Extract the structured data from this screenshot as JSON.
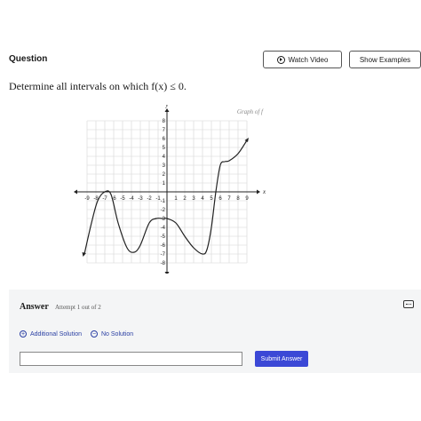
{
  "header": {
    "title": "Question",
    "watch_video": "Watch Video",
    "show_examples": "Show Examples"
  },
  "question": {
    "text": "Determine all intervals on which f(x) ≤ 0."
  },
  "graph": {
    "label": "Graph of f",
    "x_axis_label": "x",
    "y_axis_label": "y",
    "x_ticks": [
      "-9",
      "-8",
      "-7",
      "-6",
      "-5",
      "-4",
      "-3",
      "-2",
      "-1",
      "1",
      "2",
      "3",
      "4",
      "5",
      "6",
      "7",
      "8",
      "9"
    ],
    "y_ticks": [
      "8",
      "7",
      "6",
      "5",
      "4",
      "3",
      "2",
      "1",
      "-1",
      "-2",
      "-3",
      "-4",
      "-5",
      "-6",
      "-7",
      "-8"
    ]
  },
  "chart_data": {
    "type": "line",
    "title": "Graph of f",
    "xlabel": "x",
    "ylabel": "y",
    "xlim": [
      -9,
      9
    ],
    "ylim": [
      -8,
      8
    ],
    "grid": true,
    "series": [
      {
        "x": [
          -9.3,
          -8.5,
          -7.8,
          -7,
          -6.3,
          -5.5,
          -4.5,
          -3.7,
          -3,
          -2,
          -1.2,
          -0.5,
          0,
          1,
          2,
          3,
          4,
          4.5,
          5,
          5.5,
          6,
          6.5,
          7,
          8,
          9
        ],
        "y": [
          -7,
          -3.5,
          -1,
          0,
          -0.3,
          -3.5,
          -6.3,
          -6.8,
          -6,
          -3.5,
          -3,
          -3,
          -3,
          -3.5,
          -5,
          -6.3,
          -7,
          -6.5,
          -4,
          0,
          3,
          3.4,
          3.5,
          4.3,
          5.8
        ]
      }
    ]
  },
  "answer": {
    "label": "Answer",
    "attempt": "Attempt 1 out of 2",
    "additional_solution": "Additional Solution",
    "no_solution": "No Solution",
    "input_value": "",
    "submit": "Submit Answer"
  }
}
